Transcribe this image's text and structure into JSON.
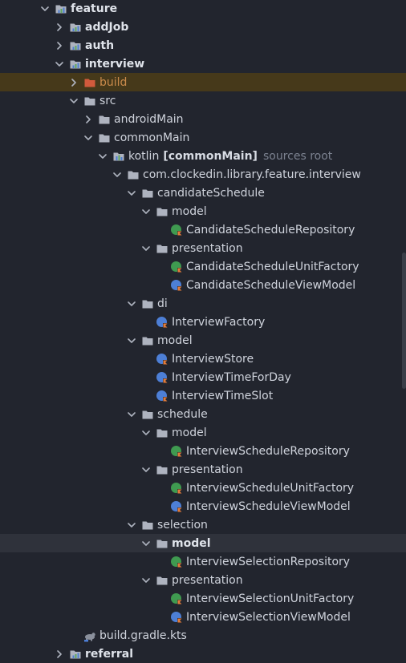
{
  "colors": {
    "background": "#22252e",
    "build_row": "#46391a",
    "highlight_row": "#2f323b",
    "folder": "#aeb3bf",
    "module_blue": "#4f7fd0",
    "module_green": "#5fa660",
    "excluded_folder": "#d25a3c",
    "kotlin_badge_green": "#3f9a50",
    "kotlin_badge_blue": "#4d7fd6",
    "hint_text": "#7c8290"
  },
  "tree": {
    "rows": [
      {
        "label": "feature",
        "icon": "module-folder-icon",
        "expanded": true,
        "level": 0,
        "bold": true
      },
      {
        "label": "addJob",
        "icon": "module-folder-icon",
        "expanded": false,
        "level": 1,
        "bold": true
      },
      {
        "label": "auth",
        "icon": "module-folder-icon",
        "expanded": false,
        "level": 1,
        "bold": true
      },
      {
        "label": "interview",
        "icon": "module-folder-icon",
        "expanded": true,
        "level": 1,
        "bold": true
      },
      {
        "label": "build",
        "icon": "excluded-folder-icon",
        "expanded": false,
        "level": 2,
        "orange": true,
        "selected": true
      },
      {
        "label": "src",
        "icon": "folder-icon",
        "expanded": true,
        "level": 2
      },
      {
        "label": "androidMain",
        "icon": "folder-icon",
        "expanded": false,
        "level": 3
      },
      {
        "label": "commonMain",
        "icon": "folder-icon",
        "expanded": true,
        "level": 3
      },
      {
        "label": "kotlin",
        "suffix": "[commonMain]",
        "hint": "sources root",
        "icon": "source-root-icon",
        "expanded": true,
        "level": 4
      },
      {
        "label": "com.clockedin.library.feature.interview",
        "icon": "folder-icon",
        "expanded": true,
        "level": 5
      },
      {
        "label": "candidateSchedule",
        "icon": "folder-icon",
        "expanded": true,
        "level": 6
      },
      {
        "label": "model",
        "icon": "folder-icon",
        "expanded": true,
        "level": 7
      },
      {
        "label": "CandidateScheduleRepository",
        "icon": "kotlin-interface-icon",
        "level": 8
      },
      {
        "label": "presentation",
        "icon": "folder-icon",
        "expanded": true,
        "level": 7
      },
      {
        "label": "CandidateScheduleUnitFactory",
        "icon": "kotlin-interface-icon",
        "level": 8
      },
      {
        "label": "CandidateScheduleViewModel",
        "icon": "kotlin-class-icon",
        "level": 8
      },
      {
        "label": "di",
        "icon": "folder-icon",
        "expanded": true,
        "level": 6
      },
      {
        "label": "InterviewFactory",
        "icon": "kotlin-class-icon",
        "level": 7
      },
      {
        "label": "model",
        "icon": "folder-icon",
        "expanded": true,
        "level": 6
      },
      {
        "label": "InterviewStore",
        "icon": "kotlin-class-icon",
        "level": 7
      },
      {
        "label": "InterviewTimeForDay",
        "icon": "kotlin-class-icon",
        "level": 7
      },
      {
        "label": "InterviewTimeSlot",
        "icon": "kotlin-class-icon",
        "level": 7
      },
      {
        "label": "schedule",
        "icon": "folder-icon",
        "expanded": true,
        "level": 6
      },
      {
        "label": "model",
        "icon": "folder-icon",
        "expanded": true,
        "level": 7
      },
      {
        "label": "InterviewScheduleRepository",
        "icon": "kotlin-interface-icon",
        "level": 8
      },
      {
        "label": "presentation",
        "icon": "folder-icon",
        "expanded": true,
        "level": 7
      },
      {
        "label": "InterviewScheduleUnitFactory",
        "icon": "kotlin-interface-icon",
        "level": 8
      },
      {
        "label": "InterviewScheduleViewModel",
        "icon": "kotlin-class-icon",
        "level": 8
      },
      {
        "label": "selection",
        "icon": "folder-icon",
        "expanded": true,
        "level": 6
      },
      {
        "label": "model",
        "icon": "folder-icon",
        "expanded": true,
        "level": 7,
        "highlight": true,
        "bold": true
      },
      {
        "label": "InterviewSelectionRepository",
        "icon": "kotlin-interface-icon",
        "level": 8
      },
      {
        "label": "presentation",
        "icon": "folder-icon",
        "expanded": true,
        "level": 7
      },
      {
        "label": "InterviewSelectionUnitFactory",
        "icon": "kotlin-interface-icon",
        "level": 8
      },
      {
        "label": "InterviewSelectionViewModel",
        "icon": "kotlin-class-icon",
        "level": 8
      },
      {
        "label": "build.gradle.kts",
        "icon": "gradle-kts-icon",
        "level": 2
      },
      {
        "label": "referral",
        "icon": "module-folder-icon",
        "expanded": false,
        "level": 1,
        "bold": true
      }
    ]
  }
}
